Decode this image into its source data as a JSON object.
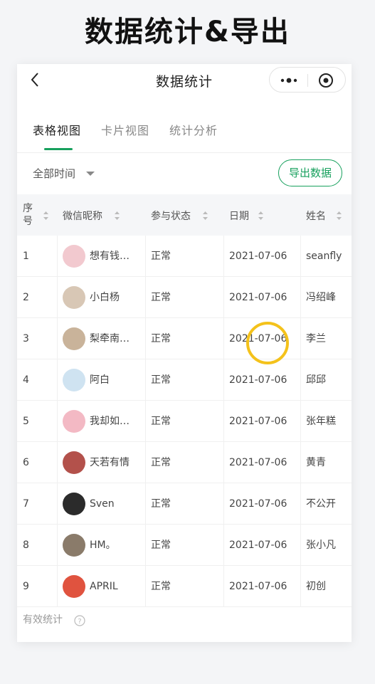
{
  "hero_title": "数据统计&导出",
  "navbar": {
    "title": "数据统计",
    "more_icon": "more-dots-icon",
    "target_icon": "target-icon"
  },
  "tabs": [
    {
      "label": "表格视图",
      "active": true
    },
    {
      "label": "卡片视图",
      "active": false
    },
    {
      "label": "统计分析",
      "active": false
    }
  ],
  "filter": {
    "time_label": "全部时间",
    "export_label": "导出数据"
  },
  "columns": {
    "seq": "序号",
    "nickname": "微信昵称",
    "status": "参与状态",
    "date": "日期",
    "name": "姓名"
  },
  "rows": [
    {
      "seq": "1",
      "nickname": "想有钱…",
      "status": "正常",
      "date": "2021-07-06",
      "name": "seanfly",
      "avatar_color": "#f2c9cf"
    },
    {
      "seq": "2",
      "nickname": "小白杨",
      "status": "正常",
      "date": "2021-07-06",
      "name": "冯绍峰",
      "avatar_color": "#d8c7b5"
    },
    {
      "seq": "3",
      "nickname": "梨牵南…",
      "status": "正常",
      "date": "2021-07-06",
      "name": "李兰",
      "avatar_color": "#c9b39a"
    },
    {
      "seq": "4",
      "nickname": "阿白",
      "status": "正常",
      "date": "2021-07-06",
      "name": "邱邱",
      "avatar_color": "#cfe3f1"
    },
    {
      "seq": "5",
      "nickname": "我却如…",
      "status": "正常",
      "date": "2021-07-06",
      "name": "张年糕",
      "avatar_color": "#f3b9c4"
    },
    {
      "seq": "6",
      "nickname": "天若有情",
      "status": "正常",
      "date": "2021-07-06",
      "name": "黄青",
      "avatar_color": "#b3514b"
    },
    {
      "seq": "7",
      "nickname": "Sven",
      "status": "正常",
      "date": "2021-07-06",
      "name": "不公开",
      "avatar_color": "#2b2b2b"
    },
    {
      "seq": "8",
      "nickname": "HM。",
      "status": "正常",
      "date": "2021-07-06",
      "name": "张小凡",
      "avatar_color": "#8a7b6a"
    },
    {
      "seq": "9",
      "nickname": "APRIL",
      "status": "正常",
      "date": "2021-07-06",
      "name": "初创",
      "avatar_color": "#e0533f"
    }
  ],
  "footer": {
    "label": "有效统计"
  },
  "colors": {
    "accent": "#17a05d",
    "cursor_ring": "#f4c21b"
  }
}
